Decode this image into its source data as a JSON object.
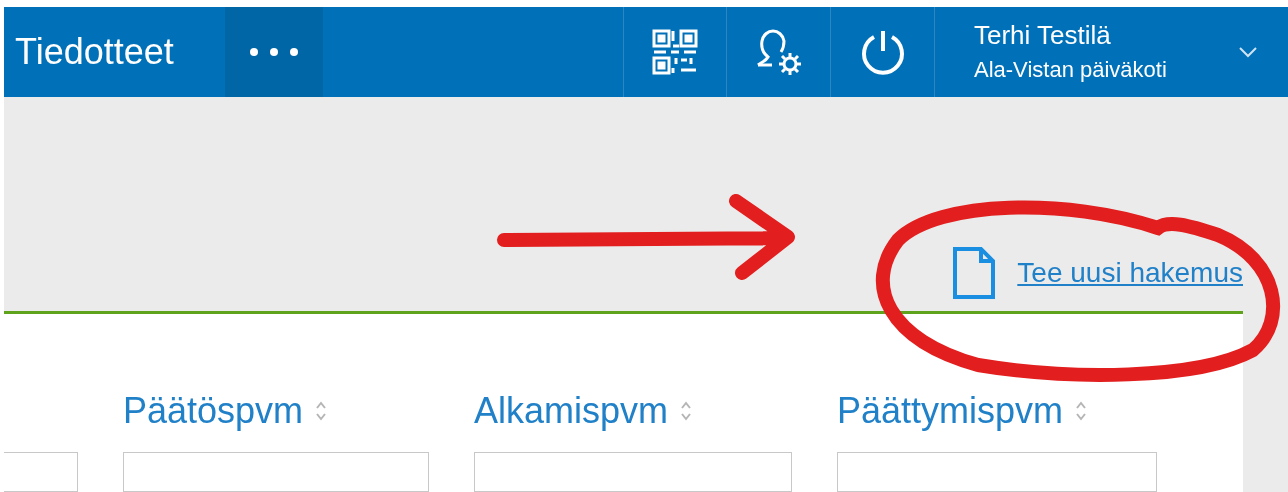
{
  "header": {
    "title": "Tiedotteet",
    "user": {
      "name": "Terhi Testilä",
      "unit": "Ala-Vistan päiväkoti"
    }
  },
  "new_application_link": "Tee uusi hakemus",
  "columns": [
    {
      "label": "Päätöspvm"
    },
    {
      "label": "Alkamispvm"
    },
    {
      "label": "Päättymispvm"
    }
  ]
}
